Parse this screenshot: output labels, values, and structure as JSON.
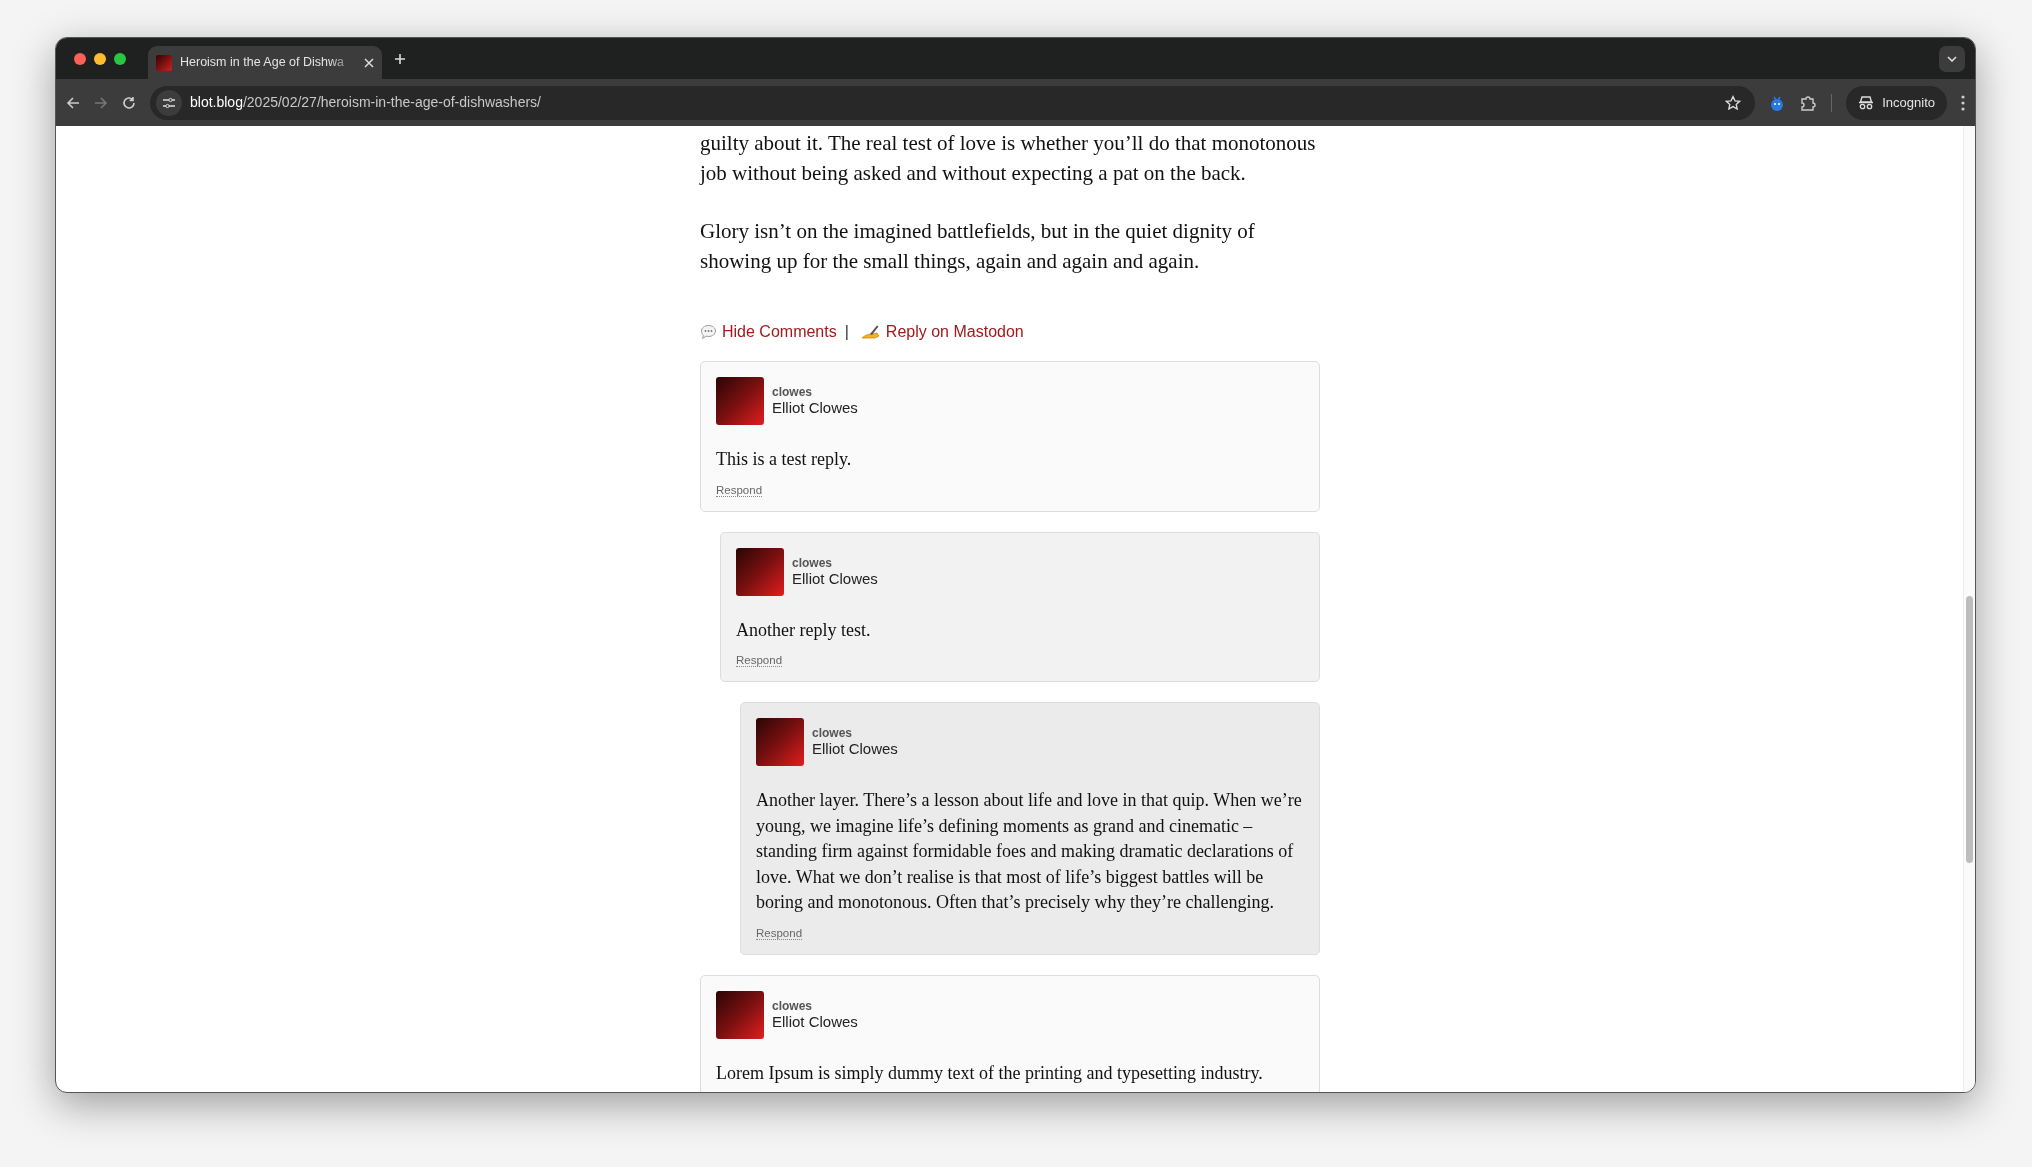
{
  "browser": {
    "tabs": [
      {
        "title": "Heroism in the Age of Dishwa",
        "selected": true
      }
    ],
    "url": {
      "host": "blot.blog",
      "path": "/2025/02/27/heroism-in-the-age-of-dishwashers/"
    },
    "profile": "Incognito"
  },
  "article": {
    "paragraphs": [
      "guilty about it. The real test of love is whether you’ll do that monotonous job without being asked and without expecting a pat on the back.",
      "Glory isn’t on the imagined battlefields, but in the quiet dignity of showing up for the small things, again and again and again."
    ]
  },
  "comment_links": [
    {
      "kind": "speech",
      "label": "Hide Comments"
    },
    {
      "kind": "write",
      "label": "Reply on Mastodon"
    }
  ],
  "separator": "|",
  "comments": [
    {
      "handle": "clowes",
      "name": "Elliot Clowes",
      "text": "This is a test reply.",
      "action": "Respond",
      "children": [
        {
          "handle": "clowes",
          "name": "Elliot Clowes",
          "text": "Another reply test.",
          "action": "Respond",
          "children": [
            {
              "handle": "clowes",
              "name": "Elliot Clowes",
              "text": "Another layer. There’s a lesson about life and love in that quip. When we’re young, we imagine life’s defining moments as grand and cinematic – standing firm against formidable foes and making dramatic declarations of love. What we don’t realise is that most of life’s biggest battles will be boring and monotonous. Often that’s precisely why they’re challenging.",
              "action": "Respond"
            }
          ]
        }
      ]
    },
    {
      "handle": "clowes",
      "name": "Elliot Clowes",
      "text": "Lorem Ipsum is simply dummy text of the printing and typesetting industry."
    }
  ]
}
